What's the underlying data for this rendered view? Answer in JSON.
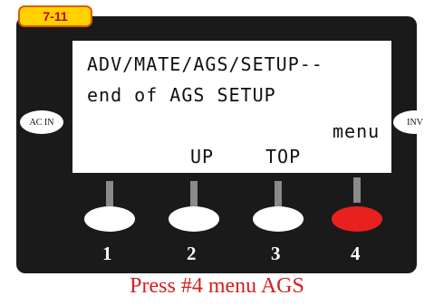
{
  "tab_label": "7-11",
  "screen": {
    "line1": "ADV/MATE/AGS/SETUP--",
    "line2": "end of AGS SETUP",
    "soft_labels": {
      "menu": "menu",
      "up": "UP",
      "top": "TOP"
    }
  },
  "side_buttons": {
    "left": "AC IN",
    "right": "INV"
  },
  "softkeys": [
    {
      "number": "1",
      "color": "#ffffff"
    },
    {
      "number": "2",
      "color": "#ffffff"
    },
    {
      "number": "3",
      "color": "#ffffff"
    },
    {
      "number": "4",
      "color": "#e8211f"
    }
  ],
  "caption": "Press #4 menu AGS"
}
